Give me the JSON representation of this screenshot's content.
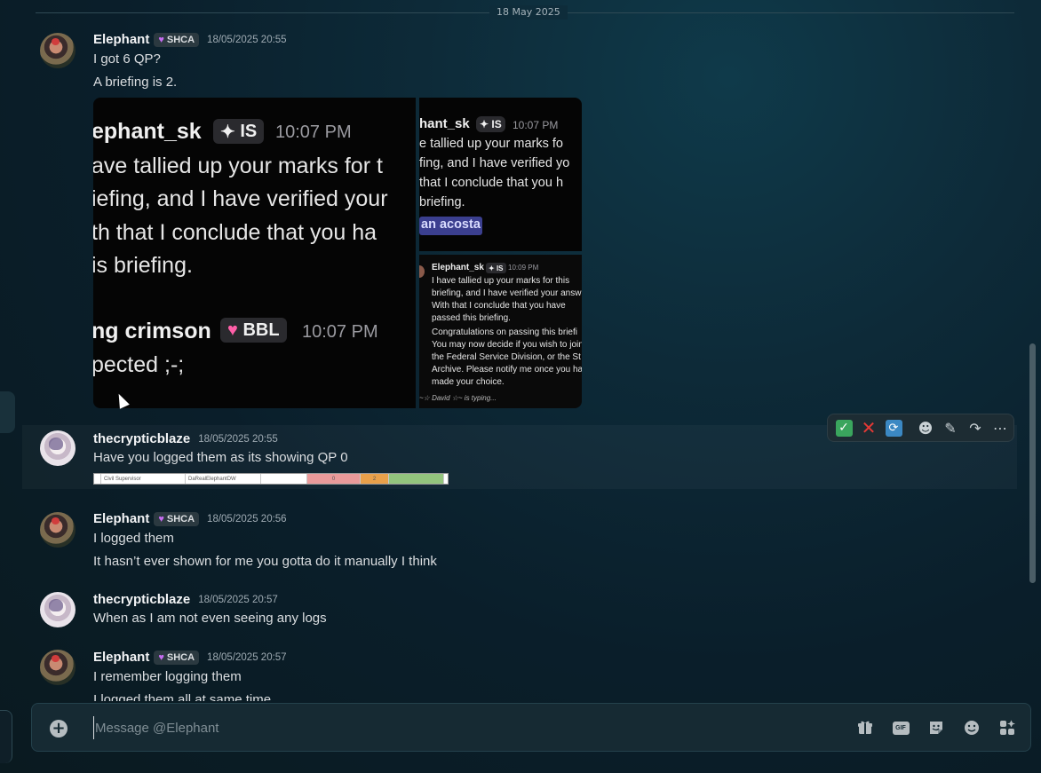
{
  "date_divider": "18 May 2025",
  "colors": {
    "accent": "#5865f2",
    "heart": "#c56cf0",
    "check": "#3aa55d",
    "cross": "#e53935"
  },
  "messages": [
    {
      "author": "Elephant",
      "badge": "SHCA",
      "timestamp": "18/05/2025 20:55",
      "lines": [
        "I got 6 QP?",
        "A briefing is 2."
      ]
    },
    {
      "author": "thecrypticblaze",
      "timestamp": "18/05/2025 20:55",
      "lines": [
        "Have you logged them as its showing QP 0"
      ]
    },
    {
      "author": "Elephant",
      "badge": "SHCA",
      "timestamp": "18/05/2025 20:56",
      "lines": [
        "I logged them",
        "It hasn’t ever shown for me you gotta do it manually I think"
      ]
    },
    {
      "author": "thecrypticblaze",
      "timestamp": "18/05/2025 20:57",
      "lines": [
        "When as I am not even seeing any logs"
      ]
    },
    {
      "author": "Elephant",
      "badge": "SHCA",
      "timestamp": "18/05/2025 20:57",
      "lines": [
        "I remember logging them",
        "I logged them all at same time"
      ]
    }
  ],
  "attachment_main": {
    "name": "ephant_sk",
    "badge": "IS",
    "time": "10:07 PM",
    "lines": [
      "ave tallied up your marks for t",
      "iefing, and I have verified your",
      "th that I conclude that you ha",
      "is briefing."
    ],
    "name2": "ng crimson",
    "badge2": "BBL",
    "time2": "10:07 PM",
    "line2": "pected ;-;"
  },
  "attachment_top_right": {
    "name": "hant_sk",
    "badge": "IS",
    "time": "10:07 PM",
    "lines": [
      "e tallied up your marks fo",
      "fing, and I have verified yo",
      "that I conclude that you h",
      "briefing."
    ],
    "mention": "an acosta"
  },
  "attachment_bottom_right": {
    "name": "Elephant_sk",
    "badge": "IS",
    "time": "10:09 PM",
    "lines": [
      "I have tallied up your marks for this",
      "briefing, and I have verified your answ",
      "With that I conclude that you have",
      "passed this briefing."
    ],
    "lines2": [
      "Congratulations on passing this briefi",
      "You may now decide if you wish to join",
      "the Federal Service Division, or the St",
      "Archive. Please notify me once you ha",
      "made your choice."
    ],
    "typing": "~☆ David ☆~ is typing..."
  },
  "table_strip": {
    "role": "Civil Supervisor",
    "user": "DaRealElephantDW",
    "value_red": "0",
    "value_orange": "2"
  },
  "toolbar": {
    "icons": [
      "check-icon",
      "cross-icon",
      "repeat-icon",
      "emoji-icon",
      "edit-icon",
      "reply-icon",
      "more-icon"
    ]
  },
  "composer": {
    "placeholder": "Message @Elephant",
    "value": ""
  }
}
